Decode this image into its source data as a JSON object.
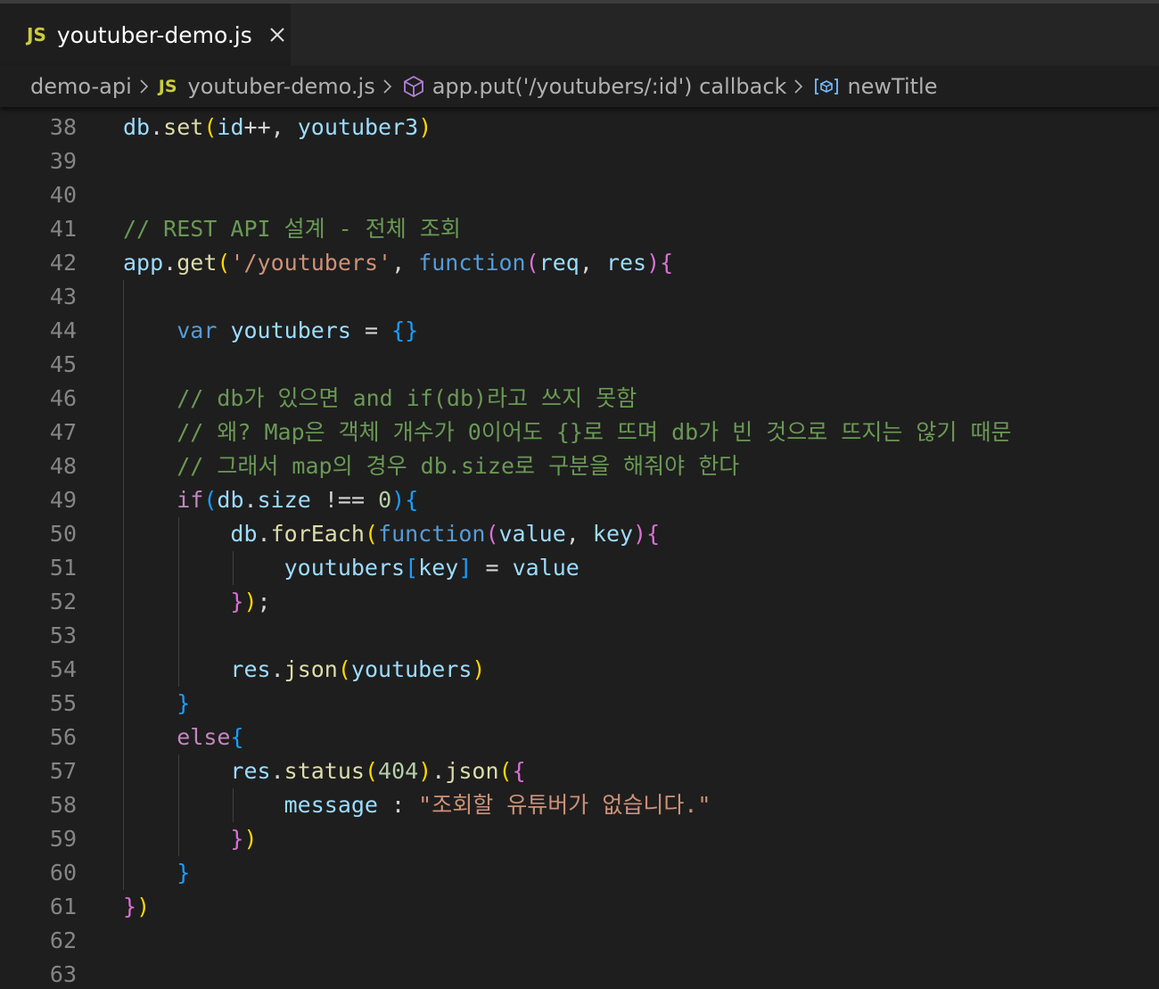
{
  "tab": {
    "badge": "JS",
    "title": "youtuber-demo.js",
    "close_icon": "close-icon"
  },
  "breadcrumb": {
    "folder": "demo-api",
    "file_badge": "JS",
    "file": "youtuber-demo.js",
    "symbol": "app.put('/youtubers/:id') callback",
    "variable": "newTitle"
  },
  "colors": {
    "background": "#1e1e1e",
    "tabbar": "#252526",
    "line_number": "#858585",
    "comment": "#6a9955",
    "keyword": "#569cd6",
    "variable": "#9cdcfe",
    "function": "#dcdcaa",
    "string": "#ce9178",
    "number": "#b5cea8",
    "control": "#c586c0"
  },
  "editor": {
    "lines": [
      {
        "n": "38",
        "code": "db.set(id++, youtuber3)"
      },
      {
        "n": "39",
        "code": ""
      },
      {
        "n": "40",
        "code": ""
      },
      {
        "n": "41",
        "code": "// REST API 설계 - 전체 조회"
      },
      {
        "n": "42",
        "code": "app.get('/youtubers', function(req, res){"
      },
      {
        "n": "43",
        "code": ""
      },
      {
        "n": "44",
        "code": "    var youtubers = {}"
      },
      {
        "n": "45",
        "code": ""
      },
      {
        "n": "46",
        "code": "    // db가 있으면 and if(db)라고 쓰지 못함"
      },
      {
        "n": "47",
        "code": "    // 왜? Map은 객체 개수가 0이어도 {}로 뜨며 db가 빈 것으로 뜨지는 않기 때문"
      },
      {
        "n": "48",
        "code": "    // 그래서 map의 경우 db.size로 구분을 해줘야 한다"
      },
      {
        "n": "49",
        "code": "    if(db.size !== 0){"
      },
      {
        "n": "50",
        "code": "        db.forEach(function(value, key){"
      },
      {
        "n": "51",
        "code": "            youtubers[key] = value"
      },
      {
        "n": "52",
        "code": "        });"
      },
      {
        "n": "53",
        "code": ""
      },
      {
        "n": "54",
        "code": "        res.json(youtubers)"
      },
      {
        "n": "55",
        "code": "    }"
      },
      {
        "n": "56",
        "code": "    else{"
      },
      {
        "n": "57",
        "code": "        res.status(404).json({"
      },
      {
        "n": "58",
        "code": "            message : \"조회할 유튜버가 없습니다.\""
      },
      {
        "n": "59",
        "code": "        })"
      },
      {
        "n": "60",
        "code": "    }"
      },
      {
        "n": "61",
        "code": "})"
      },
      {
        "n": "62",
        "code": ""
      },
      {
        "n": "63",
        "code": ""
      }
    ]
  }
}
